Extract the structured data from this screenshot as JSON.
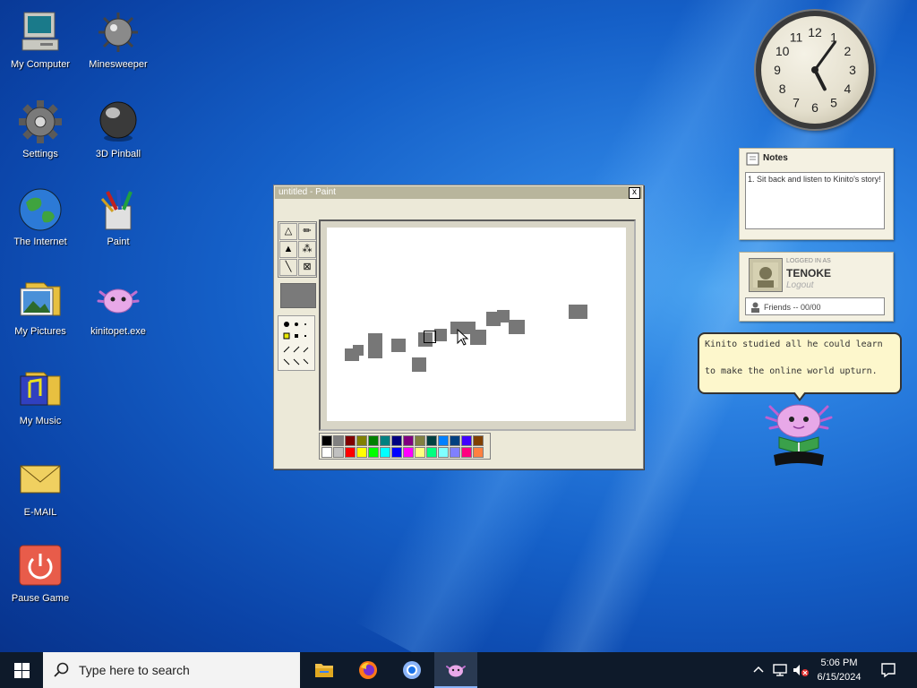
{
  "desktop": {
    "icons": [
      {
        "label": "My Computer"
      },
      {
        "label": "Minesweeper"
      },
      {
        "label": "Settings"
      },
      {
        "label": "3D Pinball"
      },
      {
        "label": "The Internet"
      },
      {
        "label": "Paint"
      },
      {
        "label": "My Pictures"
      },
      {
        "label": "kinitopet.exe"
      },
      {
        "label": "My Music"
      },
      {
        "label": "E-MAIL"
      },
      {
        "label": "Pause Game"
      }
    ]
  },
  "paint": {
    "title": "untitled - Paint",
    "close_label": "x"
  },
  "palette_colors": [
    "#000000",
    "#808080",
    "#800000",
    "#808000",
    "#008000",
    "#008080",
    "#000080",
    "#800080",
    "#808040",
    "#004040",
    "#0080ff",
    "#004080",
    "#4000ff",
    "#804000",
    "#ffffff",
    "#c0c0c0",
    "#ff0000",
    "#ffff00",
    "#00ff00",
    "#00ffff",
    "#0000ff",
    "#ff00ff",
    "#ffff80",
    "#00ff80",
    "#80ffff",
    "#8080ff",
    "#ff0080",
    "#ff8040"
  ],
  "clock": {
    "numbers": [
      "12",
      "1",
      "2",
      "3",
      "4",
      "5",
      "6",
      "7",
      "8",
      "9",
      "10",
      "11"
    ],
    "time": "5:06"
  },
  "notes": {
    "title": "Notes",
    "text": "1. Sit back and listen to Kinito's story!"
  },
  "profile": {
    "small_text": "LOGGED IN AS",
    "name": "TENOKE",
    "logout": "Logout",
    "friends": "Friends -- 00/00"
  },
  "bubble": {
    "line1": "Kinito studied all he could learn",
    "line2": "to make the online world upturn."
  },
  "taskbar": {
    "search_placeholder": "Type here to search",
    "time": "5:06 PM",
    "date": "6/15/2024"
  }
}
